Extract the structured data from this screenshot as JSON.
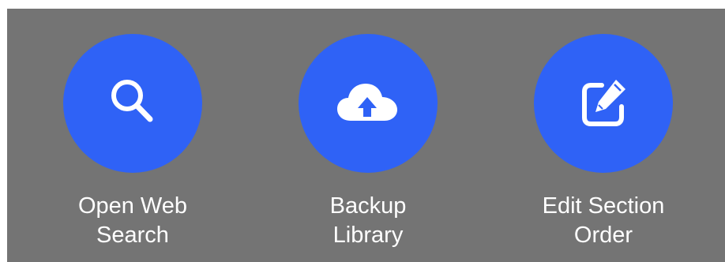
{
  "theme": {
    "panel_bg": "#747474",
    "circle_color": "#2F62F6",
    "icon_color": "#FFFFFF",
    "label_color": "#FFFFFF"
  },
  "actions": [
    {
      "icon": "search-icon",
      "label_line1": "Open Web",
      "label_line2": "Search"
    },
    {
      "icon": "cloud-upload-icon",
      "label_line1": "Backup",
      "label_line2": "Library"
    },
    {
      "icon": "edit-icon",
      "label_line1": "Edit Section",
      "label_line2": "Order"
    }
  ]
}
